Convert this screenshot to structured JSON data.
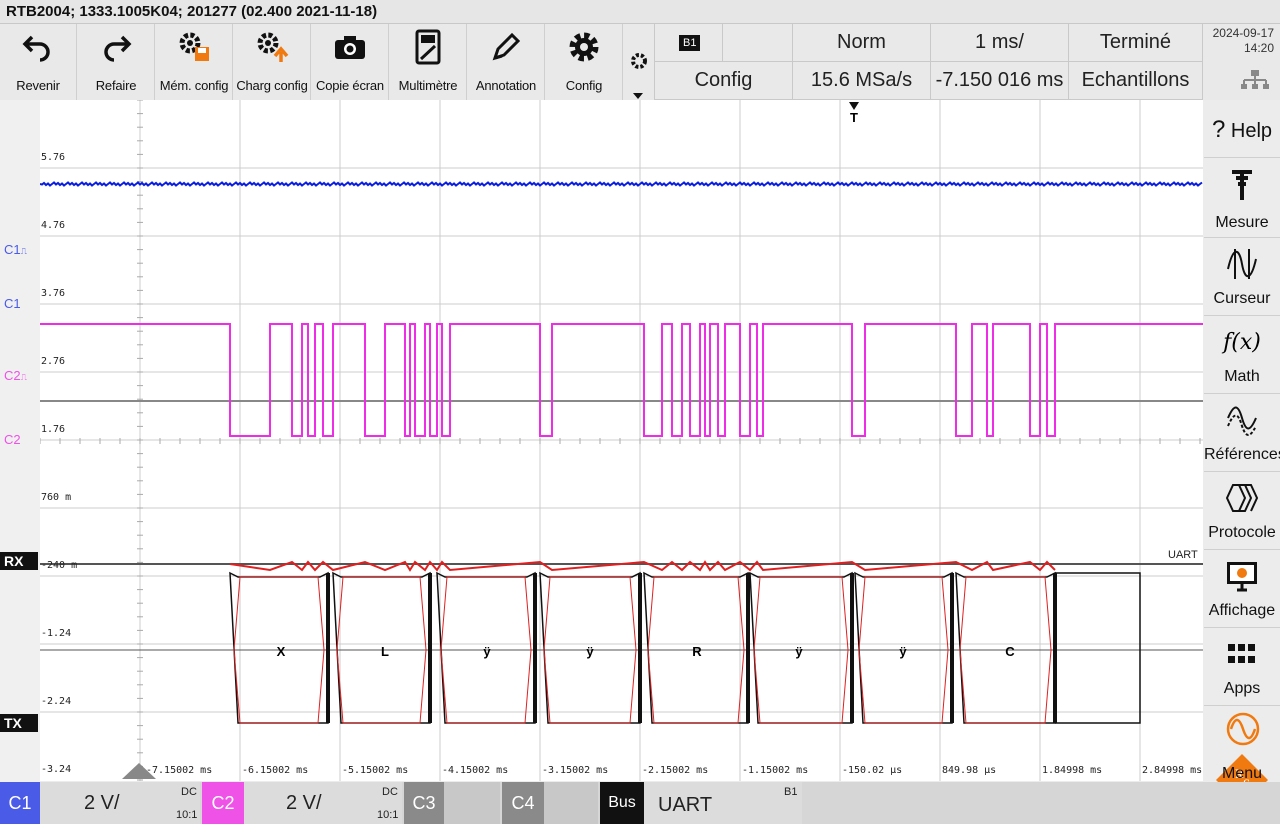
{
  "title": "RTB2004; 1333.1005K04; 201277 (02.400 2021-11-18)",
  "toolbar": [
    {
      "label": "Revenir",
      "icon": "undo-icon"
    },
    {
      "label": "Refaire",
      "icon": "redo-icon"
    },
    {
      "label": "Mém. config",
      "icon": "save-config-icon"
    },
    {
      "label": "Charg config",
      "icon": "load-config-icon"
    },
    {
      "label": "Copie écran",
      "icon": "camera-icon"
    },
    {
      "label": "Multimètre",
      "icon": "multimeter-icon"
    },
    {
      "label": "Annotation",
      "icon": "pencil-icon"
    },
    {
      "label": "Config",
      "icon": "gear-icon"
    }
  ],
  "header": {
    "bus_badge": "B1",
    "config_label": "Config",
    "trigger_mode": "Norm",
    "time_base": "1 ms/",
    "acq_state": "Terminé",
    "sample_rate": "15.6 MSa/s",
    "trigger_pos": "-7.150 016 ms",
    "acq_mode": "Echantillons",
    "date": "2024-09-17",
    "time": "14:20"
  },
  "sidebar": [
    {
      "label": "Help",
      "icon": "help-icon",
      "glyph": "?"
    },
    {
      "label": "Mesure",
      "icon": "measure-icon"
    },
    {
      "label": "Curseur",
      "icon": "cursor-icon"
    },
    {
      "label": "Math",
      "icon": "math-icon",
      "glyph": "f(x)"
    },
    {
      "label": "Références",
      "icon": "references-icon"
    },
    {
      "label": "Protocole",
      "icon": "protocol-icon"
    },
    {
      "label": "Affichage",
      "icon": "display-icon"
    },
    {
      "label": "Apps",
      "icon": "apps-icon"
    },
    {
      "label": "Menu",
      "icon": "rs-logo-icon"
    }
  ],
  "scope": {
    "trigger_marker": "T",
    "voltage_labels": [
      "5.76",
      "4.76",
      "3.76",
      "2.76",
      "1.76",
      "760 m",
      "-240 m",
      "-1.24",
      "-2.24",
      "-3.24"
    ],
    "time_labels": [
      "-7.15002 ms",
      "-6.15002 ms",
      "-5.15002 ms",
      "-4.15002 ms",
      "-3.15002 ms",
      "-2.15002 ms",
      "-1.15002 ms",
      "-150.02 µs",
      "849.98 µs",
      "1.84998 ms",
      "2.84998 ms"
    ],
    "channel_markers": [
      "C1",
      "C1",
      "C2",
      "C2"
    ],
    "rx_label": "RX",
    "tx_label": "TX",
    "bus_name": "UART",
    "decoded_symbols": [
      "X",
      "L",
      "ÿ",
      "ÿ",
      "R",
      "ÿ",
      "ÿ",
      "C"
    ],
    "colors": {
      "c1": "#0a1ee0",
      "c2": "#ee2ee6",
      "frame": "#e02020",
      "grid": "#cccccc"
    }
  },
  "bottom": {
    "c1_label": "C1",
    "c1_scale": "2 V/",
    "c1_coupling": "DC",
    "c1_probe": "10:1",
    "c2_label": "C2",
    "c2_scale": "2 V/",
    "c2_coupling": "DC",
    "c2_probe": "10:1",
    "c3_label": "C3",
    "c4_label": "C4",
    "bus_label": "Bus",
    "bus_protocol": "UART",
    "bus_id": "B1"
  }
}
